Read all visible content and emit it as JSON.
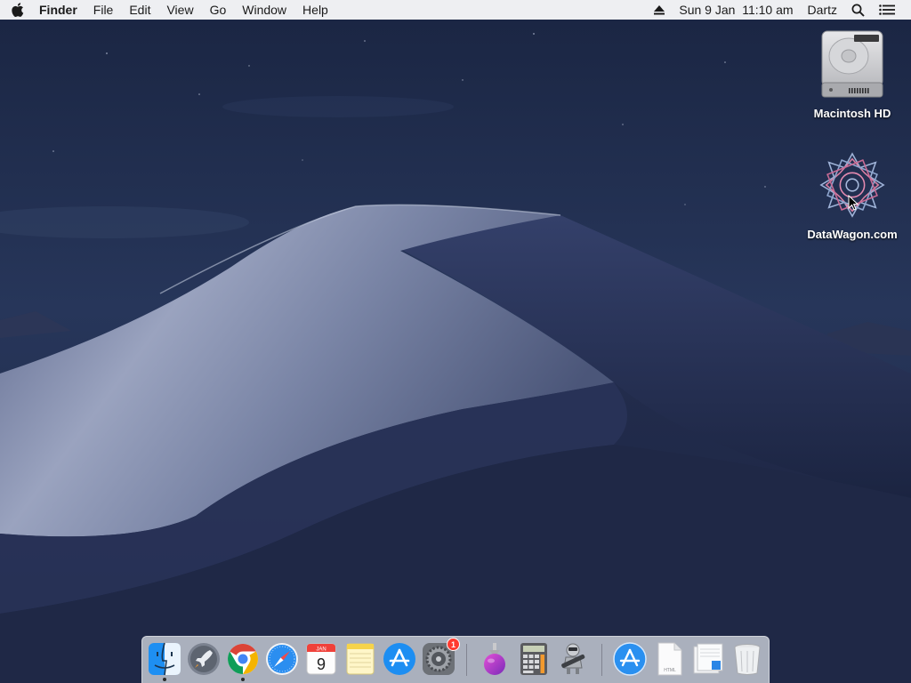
{
  "menubar": {
    "apple_icon": "apple-logo-icon",
    "app_name": "Finder",
    "menus": [
      "File",
      "Edit",
      "View",
      "Go",
      "Window",
      "Help"
    ],
    "status": {
      "eject_icon": "eject-icon",
      "datetime": "Sun 9 Jan  11:10 am",
      "user": "Dartz",
      "search_icon": "spotlight-search-icon",
      "notifications_icon": "notification-center-icon"
    }
  },
  "desktop": {
    "icons": [
      {
        "label": "Macintosh HD",
        "icon": "hard-drive-icon"
      },
      {
        "label": "DataWagon.com",
        "icon": "datawagon-logo-icon"
      }
    ]
  },
  "dock": {
    "items": [
      {
        "name": "Finder",
        "icon": "finder-icon",
        "running": true
      },
      {
        "name": "Launchpad",
        "icon": "launchpad-icon",
        "running": false
      },
      {
        "name": "Google Chrome",
        "icon": "chrome-icon",
        "running": true
      },
      {
        "name": "Safari",
        "icon": "safari-icon",
        "running": false
      },
      {
        "name": "Calendar",
        "icon": "calendar-icon",
        "running": false,
        "calendar_month": "JAN",
        "calendar_day": "9"
      },
      {
        "name": "Notes",
        "icon": "notes-icon",
        "running": false
      },
      {
        "name": "App Store",
        "icon": "app-store-icon",
        "running": false
      },
      {
        "name": "System Preferences",
        "icon": "system-preferences-icon",
        "running": false,
        "badge": "1"
      },
      {
        "name": "Installer",
        "icon": "installer-icon",
        "running": false
      },
      {
        "name": "Calculator",
        "icon": "calculator-icon",
        "running": false
      },
      {
        "name": "Automator",
        "icon": "automator-icon",
        "running": false
      },
      {
        "name": "Applications",
        "icon": "applications-folder-icon",
        "running": false
      },
      {
        "name": "Document",
        "icon": "html-document-icon",
        "running": false,
        "doc_label": "HTML"
      },
      {
        "name": "Downloads",
        "icon": "downloads-stack-icon",
        "running": false
      },
      {
        "name": "Trash",
        "icon": "trash-icon",
        "running": false
      }
    ]
  },
  "colors": {
    "menubar_bg": "#f6f6f8",
    "sky_top": "#1b2744",
    "sky_bottom": "#2e3d63",
    "dune_light": "#8c96b4",
    "dune_dark": "#222c49",
    "badge_red": "#ff3b30"
  }
}
